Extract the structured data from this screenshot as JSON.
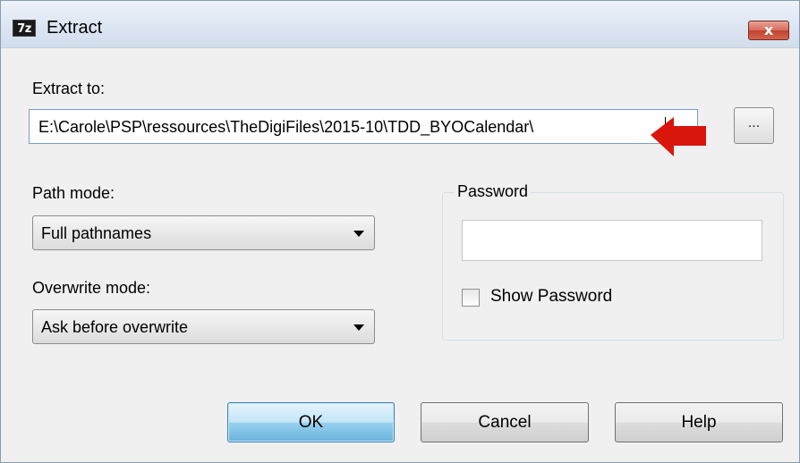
{
  "window": {
    "title": "Extract",
    "app_icon_text": "7z",
    "close_label": "x"
  },
  "extract_to": {
    "label": "Extract to:",
    "value": "E:\\Carole\\PSP\\ressources\\TheDigiFiles\\2015-10\\TDD_BYOCalendar\\",
    "browse_label": "..."
  },
  "path_mode": {
    "label": "Path mode:",
    "selected": "Full pathnames"
  },
  "overwrite_mode": {
    "label": "Overwrite mode:",
    "selected": "Ask before overwrite"
  },
  "password": {
    "group_label": "Password",
    "value": "",
    "show_password_label": "Show Password",
    "show_password_checked": false
  },
  "buttons": {
    "ok": "OK",
    "cancel": "Cancel",
    "help": "Help"
  },
  "colors": {
    "annotation_arrow": "#d9160c",
    "close_button": "#c7503c",
    "default_button": "#98d1ef"
  }
}
